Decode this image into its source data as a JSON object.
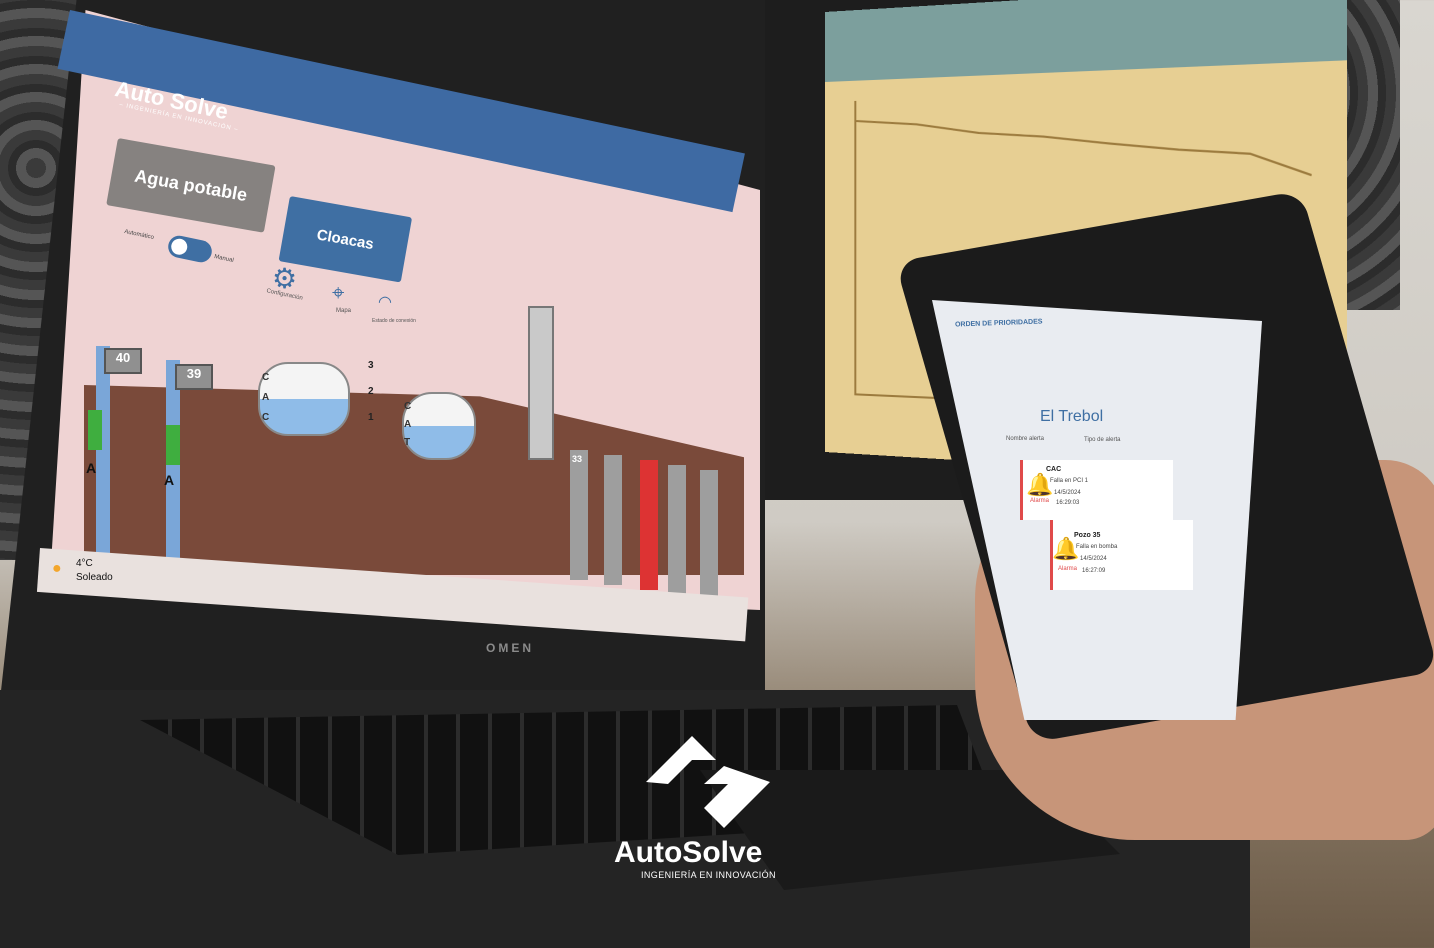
{
  "laptop": {
    "brand": "Auto Solve",
    "brand_tagline": "– INGENIERÍA EN INNOVACIÓN –",
    "tabs": [
      "Agua potable",
      "Cloacas"
    ],
    "mode_toggle": {
      "left_label": "Automático",
      "right_label": "Manual"
    },
    "toolbar_labels": [
      "Configuración",
      "Mapa",
      "Estado de conexión"
    ],
    "wells": [
      "40",
      "39"
    ],
    "well_sensor_letter": "A",
    "tank_left_letters": [
      "C",
      "A",
      "C"
    ],
    "tank_right_letters": [
      "C",
      "A",
      "T"
    ],
    "pumps": [
      "3",
      "2",
      "1"
    ],
    "bottom_well_label": "33",
    "laptop_logo": "OMEN",
    "weather": {
      "temp": "4°C",
      "desc": "Soleado"
    }
  },
  "phone": {
    "tab": "ORDEN DE PRIORIDADES",
    "title": "El Trebol",
    "filters": [
      "Nombre alerta",
      "Tipo de alerta"
    ],
    "alerts": [
      {
        "name": "CAC",
        "desc": "Falla en PCI 1",
        "date": "14/5/2024",
        "time": "16:29:03",
        "type": "Alarma"
      },
      {
        "name": "Pozo 35",
        "desc": "Falla en bomba",
        "date": "14/5/2024",
        "time": "16:27:09",
        "type": "Alarma"
      }
    ]
  },
  "watermark": {
    "name": "AutoSolve",
    "tagline": "INGENIERÍA EN INNOVACIÓN"
  },
  "colors": {
    "accent": "#3f6fa3",
    "alarm": "#e04a4a",
    "ground": "#7a4a3a",
    "water": "#7aa6d8"
  },
  "icons": [
    "gear-icon",
    "map-pin-icon",
    "wifi-icon",
    "bell-icon",
    "weather-sun-icon"
  ]
}
